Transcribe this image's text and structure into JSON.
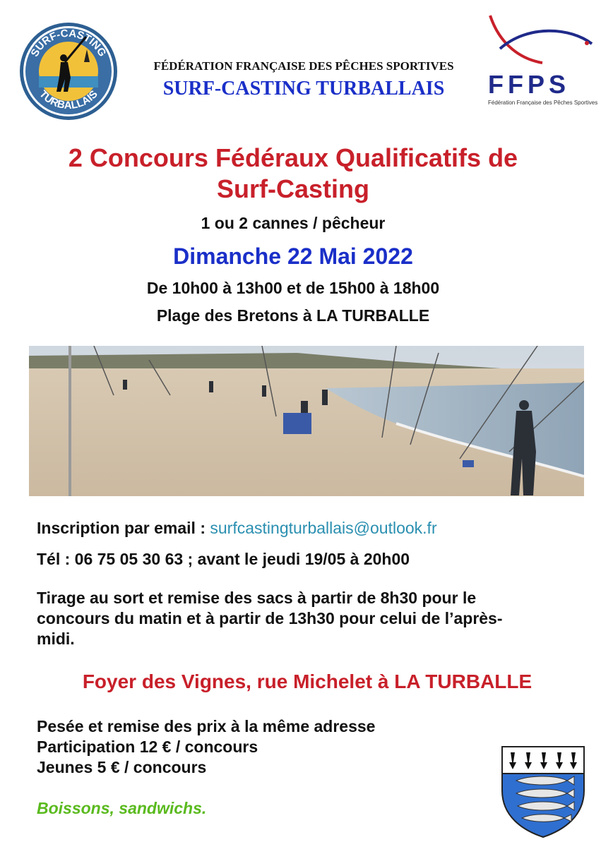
{
  "header": {
    "club_logo_text_top": "SURF-CASTING",
    "club_logo_text_bottom": "TURBALLAIS",
    "federation": "FÉDÉRATION FRANÇAISE DES PÊCHES SPORTIVES",
    "club": "SURF-CASTING TURBALLAIS",
    "ffps_logo_text": "FFPS",
    "ffps_logo_subtitle": "Fédération Française des Pêches Sportives"
  },
  "event": {
    "title_line1": "2 Concours Fédéraux Qualificatifs de",
    "title_line2": "Surf-Casting",
    "rods": "1 ou 2 cannes / pêcheur",
    "date": "Dimanche 22 Mai 2022",
    "hours": "De 10h00 à 13h00 et de 15h00 à 18h00",
    "place": "Plage des Bretons à LA TURBALLE"
  },
  "registration": {
    "label": "Inscription par email : ",
    "email": "surfcastingturballais@outlook.fr",
    "phone": "Tél : 06 75 05 30 63 ; avant le jeudi 19/05 à 20h00"
  },
  "draw": {
    "line1": "Tirage au sort et remise des sacs à partir de 8h30 pour le",
    "line2": "concours du matin et à partir de 13h30 pour celui de l’après-",
    "line3": "midi."
  },
  "venue": "Foyer des Vignes, rue Michelet à LA TURBALLE",
  "info": {
    "line1": "Pesée et remise des prix à la même adresse",
    "line2": "Participation 12 € / concours",
    "line3": "Jeunes 5 € / concours"
  },
  "drinks": "Boissons, sandwichs.",
  "colors": {
    "title_red": "#c8202a",
    "title_blue": "#1a2fc8",
    "email_teal": "#2a8fb0",
    "drinks_green": "#5aba1e"
  }
}
